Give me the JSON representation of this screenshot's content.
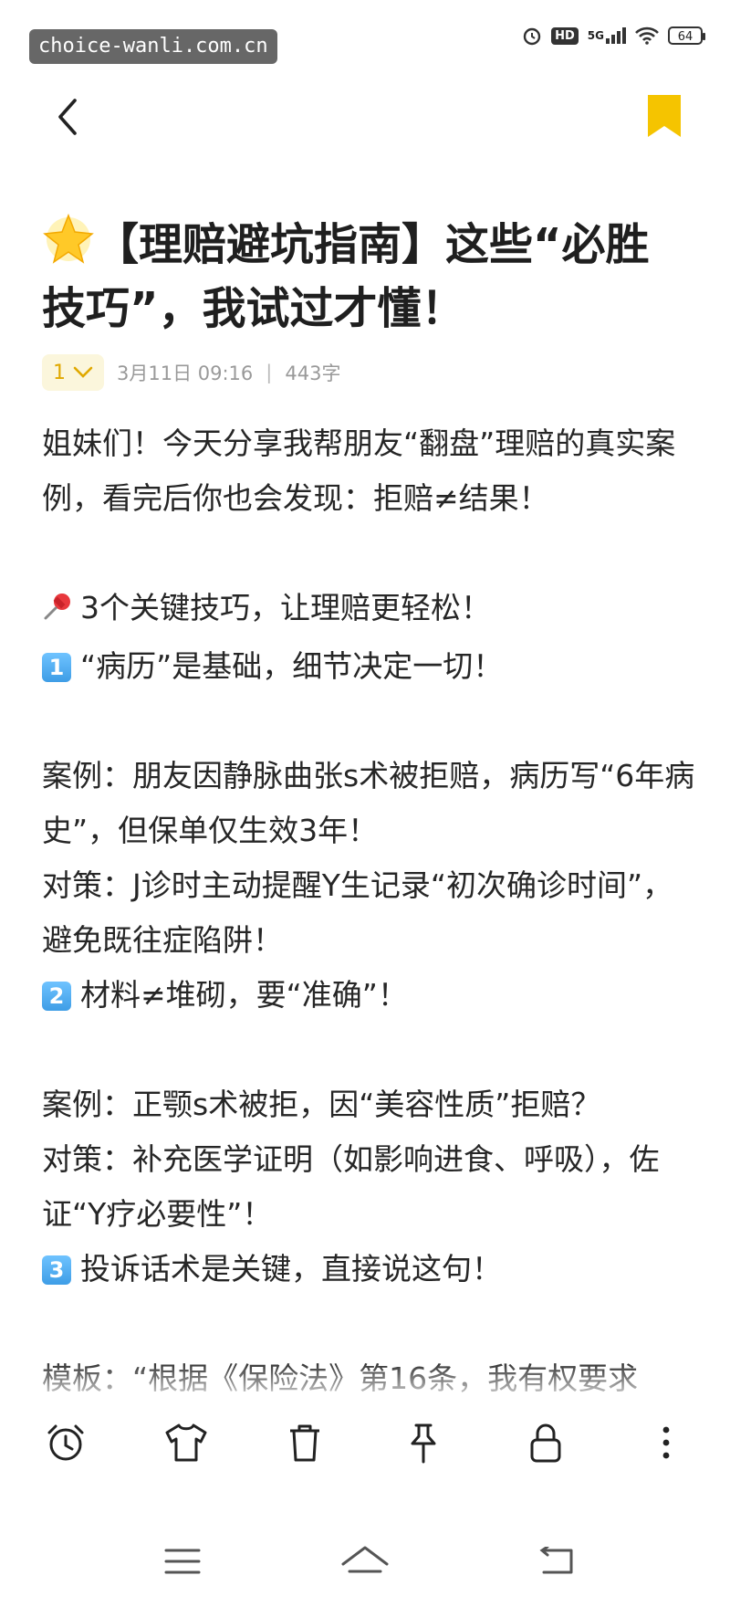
{
  "status": {
    "watermark": "choice-wanli.com.cn",
    "hd": "HD",
    "network": "5G",
    "battery": "64"
  },
  "note": {
    "title": "【理赔避坑指南】这些“必胜技巧”，我试过才懂！",
    "version": "1",
    "date": "3月11日 09:16",
    "separator": "|",
    "word_count": "443字",
    "keycaps": [
      "1",
      "2",
      "3"
    ],
    "paragraphs": [
      "姐妹们！今天分享我帮朋友“翻盘”理赔的真实案例，看完后你也会发现：拒赔≠结果！",
      "",
      "3个关键技巧，让理赔更轻松！",
      "“病历”是基础，细节决定一切！",
      "",
      "案例：朋友因静脉曲张s术被拒赔，病历写“6年病史”，但保单仅生效3年！",
      "对策：J诊时主动提醒Y生记录“初次确诊时间”，避免既往症陷阱！",
      "材料≠堆砌，要“准确”！",
      "",
      "案例：正颚s术被拒，因“美容性质”拒赔？",
      "对策：补充医学证明（如影响进食、呼吸），佐证“Y疗必要性”！",
      "投诉话术是关键，直接说这句！",
      "",
      "模板：“根据《保险法》第16条，我有权要求"
    ]
  },
  "colors": {
    "accent": "#f5c400",
    "version_bg": "#fbf6dc",
    "text": "#262626"
  },
  "icons": {
    "toolbar": [
      "alarm-clock-icon",
      "t-shirt-icon",
      "trash-icon",
      "pin-icon",
      "lock-icon",
      "more-vertical-icon"
    ],
    "nav": [
      "menu-icon",
      "home-icon",
      "back-icon"
    ]
  }
}
